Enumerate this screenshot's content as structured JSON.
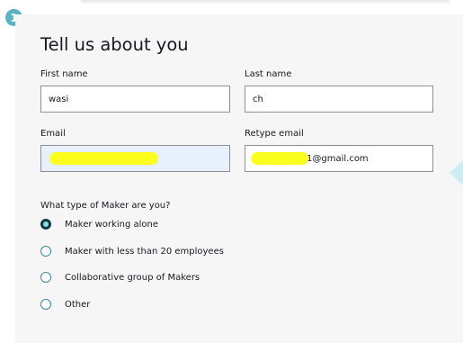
{
  "step": {
    "number": "1"
  },
  "form": {
    "title": "Tell us about you",
    "first_name": {
      "label": "First name",
      "value": "wasi"
    },
    "last_name": {
      "label": "Last name",
      "value": "ch"
    },
    "email": {
      "label": "Email",
      "value": ""
    },
    "retype_email": {
      "label": "Retype email",
      "value": "1@gmail.com"
    },
    "maker_question": "What type of Maker are you?",
    "maker_options": [
      {
        "label": "Maker working alone",
        "checked": true
      },
      {
        "label": "Maker with less than 20 employees",
        "checked": false
      },
      {
        "label": "Collaborative group of Makers",
        "checked": false
      },
      {
        "label": "Other",
        "checked": false
      }
    ]
  },
  "colors": {
    "accent": "#0d3940",
    "badge": "#5bb2c2",
    "highlight": "#ffff1e",
    "autofill": "#e8f0fe"
  }
}
